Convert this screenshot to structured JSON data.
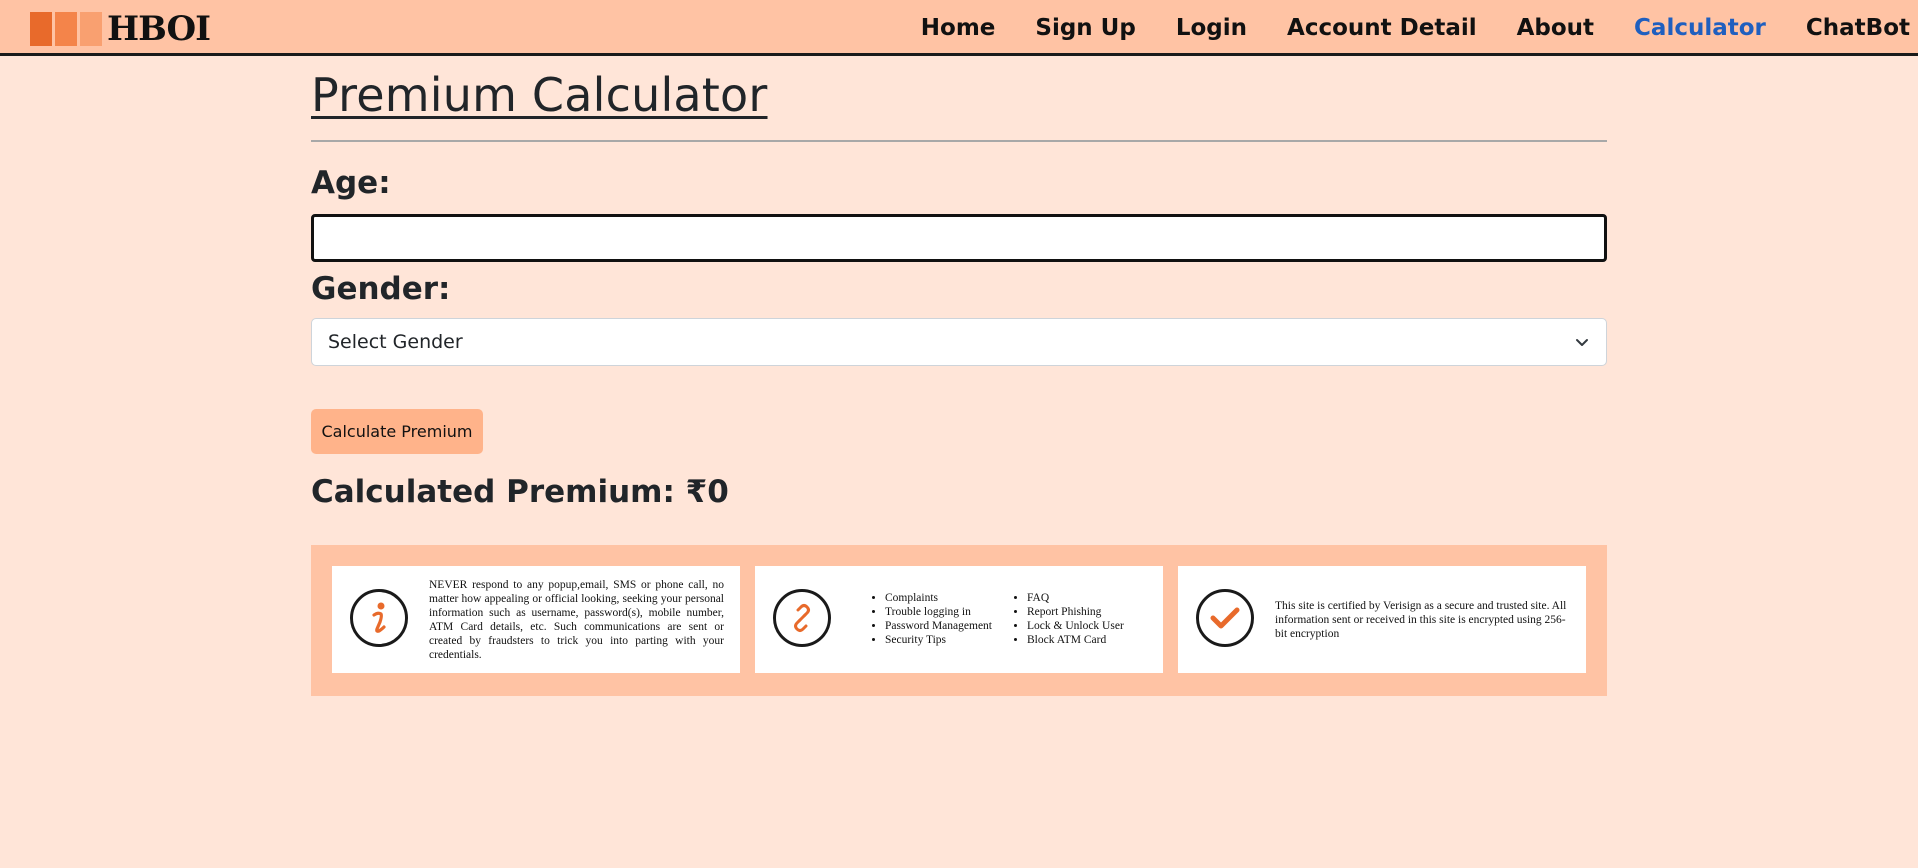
{
  "app": {
    "logo_text": "HBOI"
  },
  "nav": {
    "items": [
      {
        "label": "Home"
      },
      {
        "label": "Sign Up"
      },
      {
        "label": "Login"
      },
      {
        "label": "Account Detail"
      },
      {
        "label": "About"
      },
      {
        "label": "Calculator",
        "active": true
      },
      {
        "label": "ChatBot"
      }
    ],
    "active_color": "#1f5fbf"
  },
  "page": {
    "title": "Premium Calculator"
  },
  "form": {
    "age_label": "Age:",
    "age_value": "",
    "gender_label": "Gender:",
    "gender_selected": "Select Gender",
    "calculate_label": "Calculate Premium"
  },
  "result": {
    "text": "Calculated Premium: ₹0"
  },
  "info_cards": {
    "warning": {
      "icon": "info-icon",
      "text": "NEVER respond to any popup,email, SMS or phone call, no matter how appealing or official looking, seeking your personal information such as username, password(s), mobile number, ATM Card details, etc. Such communications are sent or created by fraudsters to trick you into parting with your credentials."
    },
    "links": {
      "icon": "link-icon",
      "col1": [
        "Complaints",
        "Trouble logging in",
        "Password Management",
        "Security Tips"
      ],
      "col2": [
        "FAQ",
        "Report Phishing",
        "Lock & Unlock User",
        "Block ATM Card"
      ]
    },
    "security": {
      "icon": "checkmark-icon",
      "text": "This site is certified by Verisign as a secure and trusted site. All information sent or received in this site is encrypted using 256-bit encryption"
    }
  },
  "colors": {
    "page_bg": "#ffe5d8",
    "navbar_bg": "#ffc3a4",
    "button_bg": "#ffb38a",
    "accent_orange": "#e86a2b"
  }
}
